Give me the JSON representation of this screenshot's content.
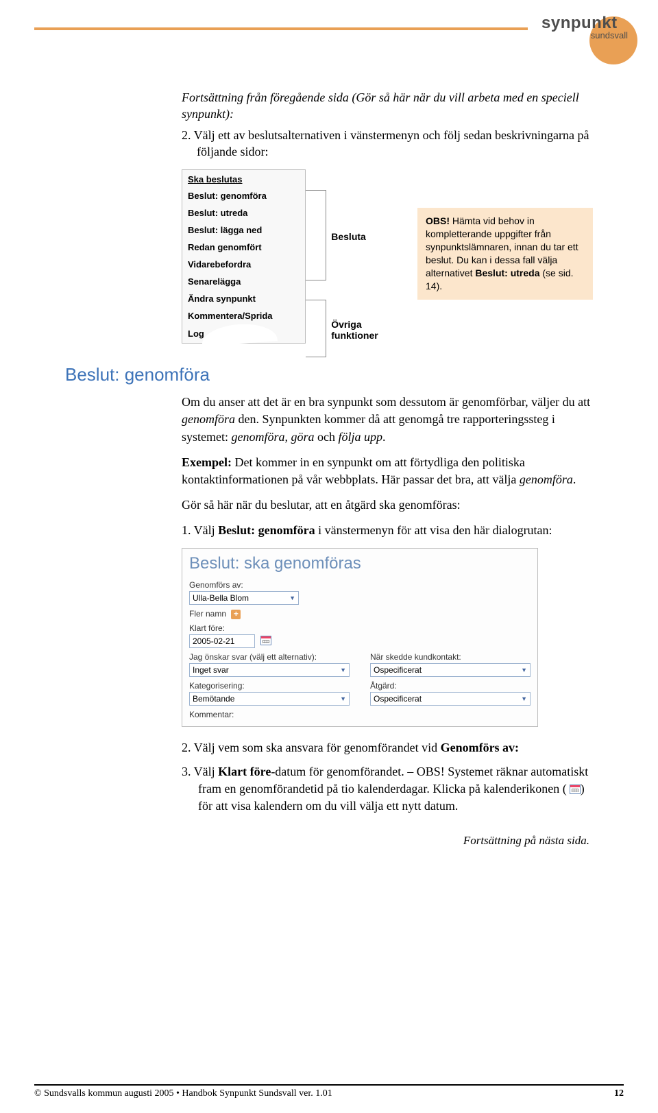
{
  "logo": {
    "line1": "synpunkt",
    "line2": "sundsvall"
  },
  "intro": "Fortsättning från föregående sida (Gör så här när du vill arbeta med en speciell synpunkt):",
  "step2": "2.  Välj ett av beslutsalternativen i vänstermenyn och följ sedan beskrivningarna på följande sidor:",
  "menu": {
    "heading": "Ska beslutas",
    "items": [
      "Beslut: genomföra",
      "Beslut: utreda",
      "Beslut: lägga ned",
      "Redan genomfört",
      "Vidarebefordra",
      "Senarelägga",
      "Ändra synpunkt",
      "Kommentera/Sprida"
    ],
    "last": "Log"
  },
  "bracket_labels": {
    "l1": "Besluta",
    "l2": "Övriga funktioner"
  },
  "obs": {
    "title": "OBS!",
    "body1": " Hämta vid behov in kompletterande uppgifter från synpunktslämnaren, innan du tar ett beslut. Du kan i dessa fall välja alternativet ",
    "bold": "Beslut: utreda",
    "body2": " (se sid. 14)."
  },
  "section_h": "Beslut: genomföra",
  "para1_a": "Om du anser att det är en bra synpunkt som dessutom är genomförbar, väljer du att ",
  "para1_em1": "genomföra",
  "para1_b": " den. Synpunkten kommer då att genomgå tre rapporteringssteg i systemet: ",
  "para1_em2": "genomföra",
  "para1_c": ", ",
  "para1_em3": "göra",
  "para1_d": " och ",
  "para1_em4": "följa upp",
  "para1_e": ".",
  "para2_strong": "Exempel:",
  "para2_a": " Det kommer in en synpunkt om att förtydliga den politiska kontaktinformationen på vår webbplats. Här passar det bra, att välja ",
  "para2_em": "genomföra",
  "para2_b": ".",
  "para3": "Gör så här när du beslutar, att en åtgärd ska genomföras:",
  "step_d1_a": "1.  Välj ",
  "step_d1_strong": "Beslut: genomföra",
  "step_d1_b": " i vänstermenyn för att visa den här dialogrutan:",
  "dialog": {
    "title": "Beslut: ska genomföras",
    "l_genomfors": "Genomförs av:",
    "v_genomfors": "Ulla-Bella Blom",
    "l_fler": "Fler namn",
    "l_klart": "Klart före:",
    "v_klart": "2005-02-21",
    "l_svar": "Jag önskar svar (välj ett alternativ):",
    "v_svar": "Inget svar",
    "l_kund": "När skedde kundkontakt:",
    "v_kund": "Ospecificerat",
    "l_kat": "Kategorisering:",
    "v_kat": "Bemötande",
    "l_atgard": "Åtgärd:",
    "v_atgard": "Ospecificerat",
    "l_kommentar": "Kommentar:"
  },
  "post_steps": {
    "s2_a": "2.  Välj vem som ska ansvara för genomförandet vid ",
    "s2_strong": "Genomförs av:",
    "s3_a": "3.  Välj ",
    "s3_strong": "Klart före",
    "s3_b": "-datum för genomförandet. – OBS! Systemet räknar automatiskt fram en genomförandetid på tio kalenderdagar. Klicka på kalenderikonen (",
    "s3_c": ") för att visa kalendern om du vill välja ett nytt datum."
  },
  "continuation": "Fortsättning på nästa sida.",
  "footer": {
    "left": "© Sundsvalls kommun augusti 2005 • Handbok Synpunkt Sundsvall ver. 1.01",
    "right": "12"
  }
}
